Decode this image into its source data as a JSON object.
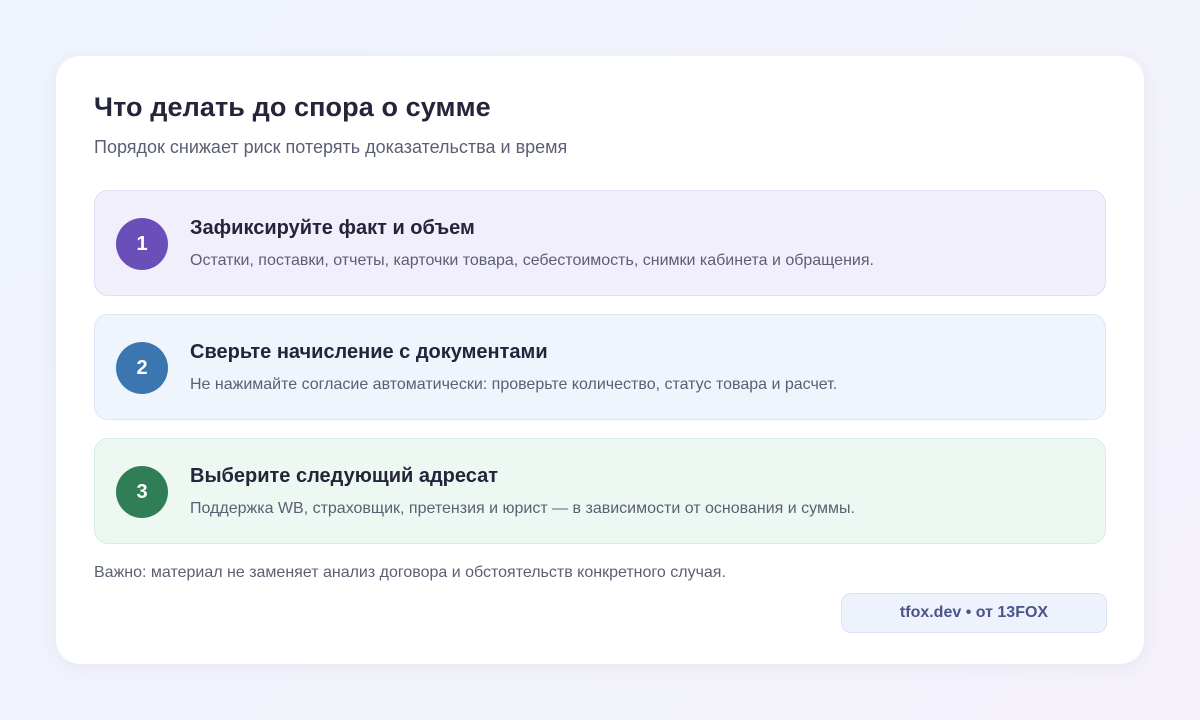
{
  "header": {
    "title": "Что делать до спора о сумме",
    "subtitle": "Порядок снижает риск потерять доказательства и время"
  },
  "steps": [
    {
      "number": "1",
      "title": "Зафиксируйте факт и объем",
      "description": "Остатки, поставки, отчеты, карточки товара, себестоимость, снимки кабинета и обращения.",
      "accent_color": "#6b4fb8"
    },
    {
      "number": "2",
      "title": "Сверьте начисление с документами",
      "description": "Не нажимайте согласие автоматически: проверьте количество, статус товара и расчет.",
      "accent_color": "#3b76b0"
    },
    {
      "number": "3",
      "title": "Выберите следующий адресат",
      "description": "Поддержка WB, страховщик, претензия и юрист — в зависимости от основания и суммы.",
      "accent_color": "#2f7e56"
    }
  ],
  "footer": {
    "note": "Важно: материал не заменяет анализ договора и обстоятельств конкретного случая.",
    "badge": "tfox.dev • от 13FOX"
  }
}
